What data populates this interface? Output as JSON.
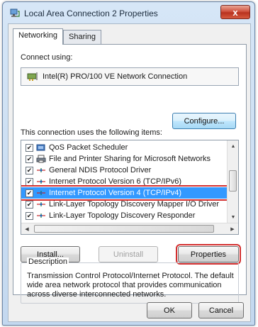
{
  "window": {
    "title": "Local Area Connection 2 Properties",
    "close_label": "x"
  },
  "tabs": [
    {
      "label": "Networking",
      "active": true
    },
    {
      "label": "Sharing",
      "active": false
    }
  ],
  "connect_using": {
    "label": "Connect using:",
    "adapter": "Intel(R) PRO/100 VE Network Connection"
  },
  "configure_button": "Configure...",
  "items_section": {
    "label": "This connection uses the following items:",
    "items": [
      {
        "label": "QoS Packet Scheduler",
        "checked": true,
        "icon": "qos-icon"
      },
      {
        "label": "File and Printer Sharing for Microsoft Networks",
        "checked": true,
        "icon": "printer-icon"
      },
      {
        "label": "General NDIS Protocol Driver",
        "checked": true,
        "icon": "protocol-icon"
      },
      {
        "label": "Internet Protocol Version 6 (TCP/IPv6)",
        "checked": true,
        "icon": "protocol-icon"
      },
      {
        "label": "Internet Protocol Version 4 (TCP/IPv4)",
        "checked": true,
        "icon": "protocol-icon",
        "selected": true
      },
      {
        "label": "Link-Layer Topology Discovery Mapper I/O Driver",
        "checked": true,
        "icon": "protocol-icon"
      },
      {
        "label": "Link-Layer Topology Discovery Responder",
        "checked": true,
        "icon": "protocol-icon"
      }
    ]
  },
  "buttons": {
    "install": "Install...",
    "uninstall": "Uninstall",
    "properties": "Properties",
    "ok": "OK",
    "cancel": "Cancel"
  },
  "description": {
    "title": "Description",
    "text": "Transmission Control Protocol/Internet Protocol. The default wide area network protocol that provides communication across diverse interconnected networks."
  },
  "colors": {
    "selection": "#3399ff",
    "highlight": "#d32f2f"
  }
}
